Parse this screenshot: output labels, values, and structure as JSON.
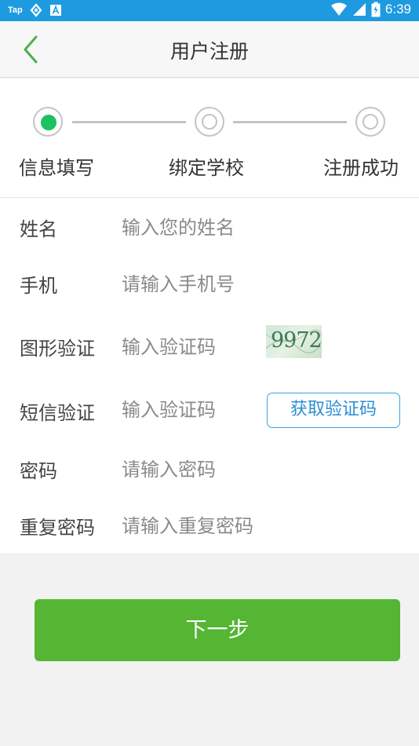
{
  "status_bar": {
    "app_badge": "Tap",
    "time": "6:39",
    "icons": [
      "tap-badge",
      "sync-icon",
      "a-box-icon",
      "wifi-icon",
      "signal-icon",
      "battery-icon"
    ]
  },
  "header": {
    "title": "用户注册",
    "back_icon": "chevron-left-icon"
  },
  "steps": [
    {
      "label": "信息填写",
      "state": "active"
    },
    {
      "label": "绑定学校",
      "state": "pending"
    },
    {
      "label": "注册成功",
      "state": "pending"
    }
  ],
  "form": {
    "name": {
      "label": "姓名",
      "placeholder": "输入您的姓名"
    },
    "phone": {
      "label": "手机",
      "placeholder": "请输入手机号"
    },
    "captcha": {
      "label": "图形验证",
      "placeholder": "输入验证码",
      "image_text": "9972"
    },
    "sms": {
      "label": "短信验证",
      "placeholder": "输入验证码",
      "button": "获取验证码"
    },
    "password": {
      "label": "密码",
      "placeholder": "请输入密码"
    },
    "confirm": {
      "label": "重复密码",
      "placeholder": "请输入重复密码"
    }
  },
  "next_button": "下一步",
  "colors": {
    "status_bar": "#1e9be0",
    "active_step": "#1cc260",
    "primary_button": "#55b634",
    "link_blue": "#2a8fd6",
    "back_arrow": "#4caf50"
  }
}
